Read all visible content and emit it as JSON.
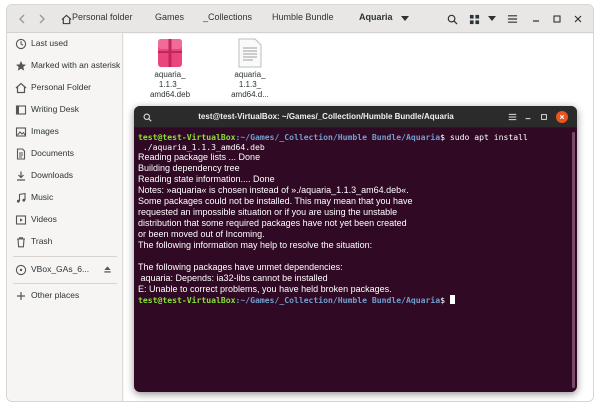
{
  "file_manager": {
    "breadcrumbs": [
      "Personal folder",
      "Games",
      "_Collections",
      "Humble Bundle",
      "Aquaria"
    ],
    "sidebar": {
      "items": [
        {
          "label": "Last used",
          "icon": "clock-icon"
        },
        {
          "label": "Marked with an asterisk",
          "icon": "star-icon"
        },
        {
          "label": "Personal Folder",
          "icon": "home-icon"
        },
        {
          "label": "Writing Desk",
          "icon": "desktop-icon"
        },
        {
          "label": "Images",
          "icon": "image-icon"
        },
        {
          "label": "Documents",
          "icon": "document-icon"
        },
        {
          "label": "Downloads",
          "icon": "download-icon"
        },
        {
          "label": "Music",
          "icon": "music-icon"
        },
        {
          "label": "Videos",
          "icon": "video-icon"
        },
        {
          "label": "Trash",
          "icon": "trash-icon"
        }
      ],
      "device": {
        "label": "VBox_GAs_6...",
        "icon": "disc-icon"
      },
      "other_places": {
        "label": "Other places",
        "icon": "plus-icon"
      }
    },
    "files": [
      {
        "lines": [
          "aquaria_",
          "1.1.3_",
          "amd64.deb"
        ],
        "icon": "package-icon"
      },
      {
        "lines": [
          "aquaria_",
          "1.1.3_",
          "amd64.d..."
        ],
        "icon": "text-file-icon"
      }
    ]
  },
  "terminal": {
    "title": "test@test-VirtualBox: ~/Games/_Collection/Humble Bundle/Aquaria",
    "prompt_user": "test@test-VirtualBox",
    "prompt_path": ":~/Games/_Collection/Humble Bundle/Aquaria",
    "prompt_symbol": "$",
    "command": " sudo apt install",
    "command_cont": " ./aquaria_1.1.3_amd64.deb",
    "output": [
      "Reading package lists ... Done",
      "Building dependency tree",
      "Reading state information.... Done",
      "Notes: »aquaria« is chosen instead of »./aquaria_1.1.3_am64.deb«.",
      "Some packages could not be installed. This may mean that you have",
      "requested an impossible situation or if you are using the unstable",
      "distribution that some required packages have not yet been created",
      "or been moved out of Incoming.",
      "The following information may help to resolve the situation:",
      "",
      "The following packages have unmet dependencies:",
      " aquaria: Depends: ia32-libs cannot be installed",
      "E: Unable to correct problems, you have held broken packages."
    ]
  },
  "colors": {
    "terminal_bg": "#300a24",
    "prompt_user": "#8ae234",
    "prompt_path": "#729fcf",
    "accent": "#e95420"
  }
}
